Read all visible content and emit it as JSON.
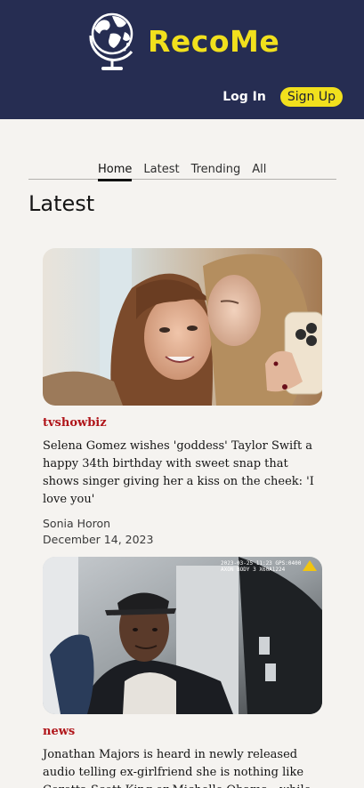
{
  "header": {
    "brand": "RecoMe",
    "login_label": "Log In",
    "signup_label": "Sign Up"
  },
  "nav": {
    "tabs": [
      "Home",
      "Latest",
      "Trending",
      "All"
    ],
    "active": "Home"
  },
  "section": {
    "title": "Latest"
  },
  "articles": [
    {
      "category": "tvshowbiz",
      "headline": "Selena Gomez wishes 'goddess' Taylor Swift a happy 34th birthday with sweet snap that shows singer giving her a kiss on the cheek: 'I love you'",
      "author": "Sonia Horon",
      "date": "December 14, 2023"
    },
    {
      "category": "news",
      "headline": "Jonathan Majors is heard in newly released audio telling ex-girlfriend she is nothing like Coretta Scott King or Michelle Obama - while he does",
      "image_overlay": "2023-03-25 11:23 GPS:0400 AXON BODY 3 X60A1224"
    }
  ],
  "colors": {
    "header_bg": "#262d52",
    "brand_yellow": "#f1e01d",
    "category_red": "#b0151a",
    "page_bg": "#f5f3f0"
  }
}
